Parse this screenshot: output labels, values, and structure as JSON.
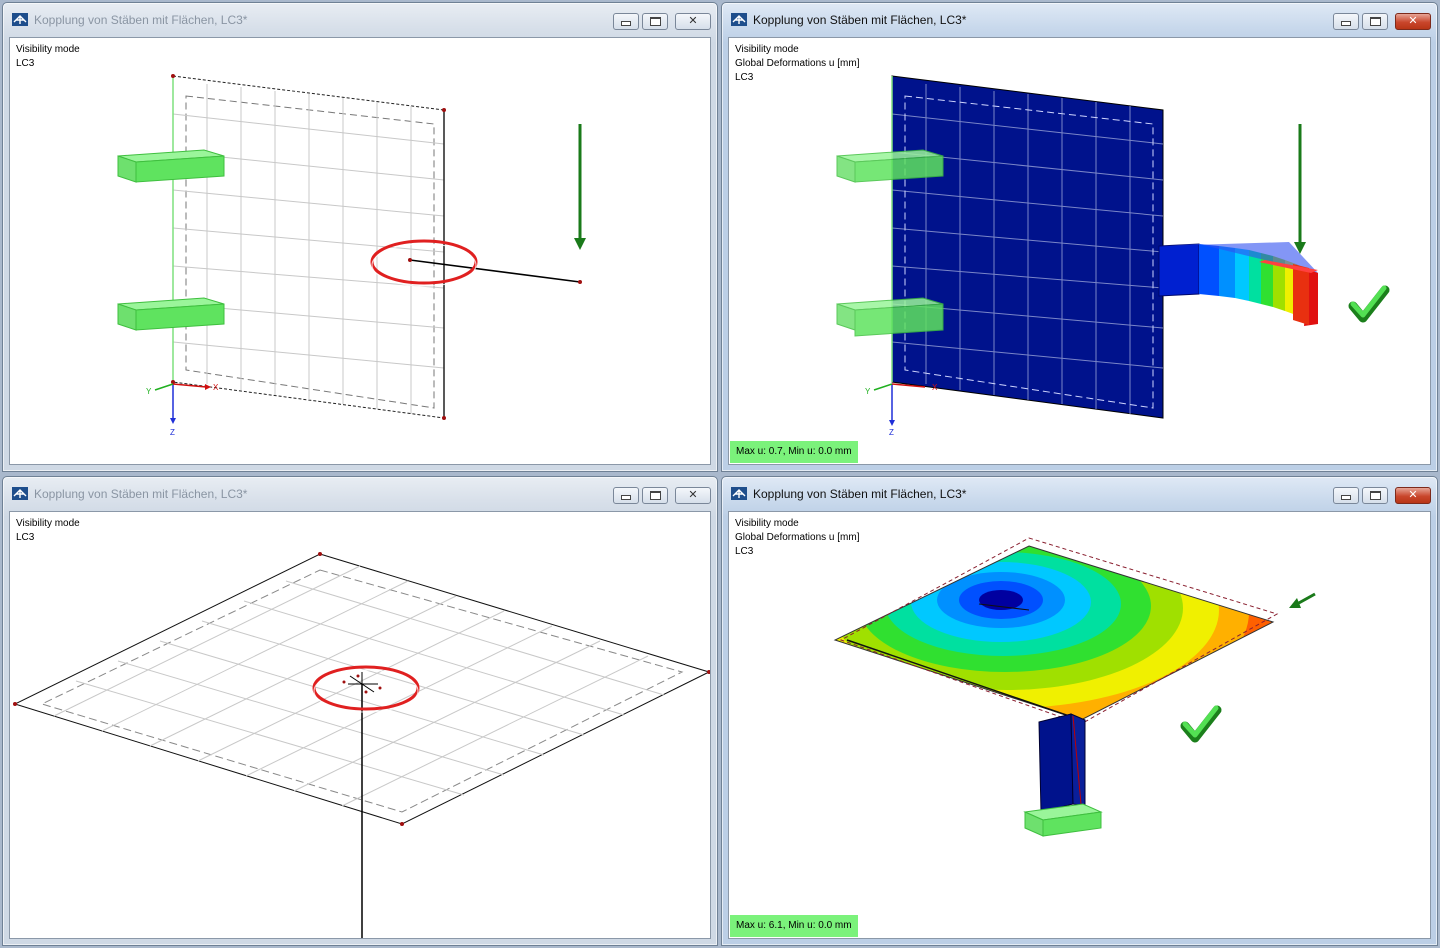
{
  "windows": [
    {
      "title": "Kopplung von Stäben mit Flächen, LC3*",
      "active": false,
      "info_lines": [
        "Visibility mode",
        "LC3"
      ],
      "axes": {
        "x": "X",
        "y": "Y",
        "z": "Z"
      }
    },
    {
      "title": "Kopplung von Stäben mit Flächen, LC3*",
      "active": true,
      "info_lines": [
        "Visibility mode",
        "Global Deformations u [mm]",
        "LC3"
      ],
      "result_label": "Max u: 0.7, Min u: 0.0 mm",
      "axes": {
        "x": "X",
        "y": "Y",
        "z": "Z"
      }
    },
    {
      "title": "Kopplung von Stäben mit Flächen, LC3*",
      "active": false,
      "info_lines": [
        "Visibility mode",
        "LC3"
      ]
    },
    {
      "title": "Kopplung von Stäben mit Flächen, LC3*",
      "active": true,
      "info_lines": [
        "Visibility mode",
        "Global Deformations u [mm]",
        "LC3"
      ],
      "result_label": "Max u: 6.1, Min u: 0.0 mm"
    }
  ],
  "icons": {
    "app": "rfem-app-icon",
    "minimize": "minimize-icon",
    "maximize": "maximize-icon",
    "close": "close-icon",
    "check": "check-mark-icon",
    "load": "load-arrow-icon",
    "highlight": "highlight-circle"
  },
  "colors": {
    "support": "#5fe35f",
    "surface_result": "#00128c",
    "load_arrow": "#1a7a1a",
    "highlight": "#e02020",
    "check": "#3cc83c",
    "result_label_bg": "#7bf27b",
    "contour_scale": [
      "#0000a0",
      "#0050ff",
      "#00c8ff",
      "#00e0a0",
      "#30e030",
      "#a0e000",
      "#f0f000",
      "#ffb000",
      "#ff6000",
      "#e01010"
    ]
  }
}
